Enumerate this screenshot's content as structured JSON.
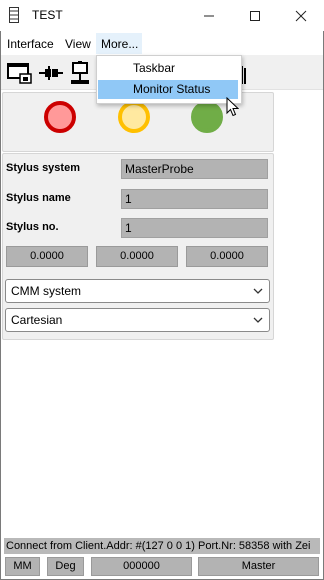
{
  "window": {
    "title": "TEST",
    "minimize_glyph": "—",
    "maximize_glyph": "☐",
    "close_glyph": "✕"
  },
  "menu": {
    "items": [
      "Interface",
      "View",
      "More..."
    ]
  },
  "dropdown": {
    "items": [
      "Taskbar",
      "Monitor Status"
    ],
    "highlighted": "Monitor Status"
  },
  "toolbar": {
    "icons": [
      "monitor-disconnect-icon",
      "plug-connector-icon",
      "probe-head-icon",
      "wrench-icon",
      "hand-icon"
    ]
  },
  "status_lights": [
    {
      "name": "red",
      "fill": "#ff9999",
      "ring": "#cc0000"
    },
    {
      "name": "yellow",
      "fill": "#ffe9a0",
      "ring": "#ffc000"
    },
    {
      "name": "green",
      "fill": "#70ad47",
      "ring": "#70ad47"
    }
  ],
  "stylus": {
    "system_label": "Stylus system",
    "system_value": "MasterProbe",
    "name_label": "Stylus name",
    "name_value": "1",
    "number_label": "Stylus no.",
    "number_value": "1"
  },
  "coordinates": [
    "0.0000",
    "0.0000",
    "0.0000"
  ],
  "dropdowns": {
    "system": "CMM system",
    "coord_type": "Cartesian"
  },
  "status": {
    "message": "Connect from Client.Addr: #(127 0 0 1) Port.Nr: 58358 with Zei",
    "unit": "MM",
    "angle": "Deg",
    "code": "000000",
    "mode": "Master"
  }
}
